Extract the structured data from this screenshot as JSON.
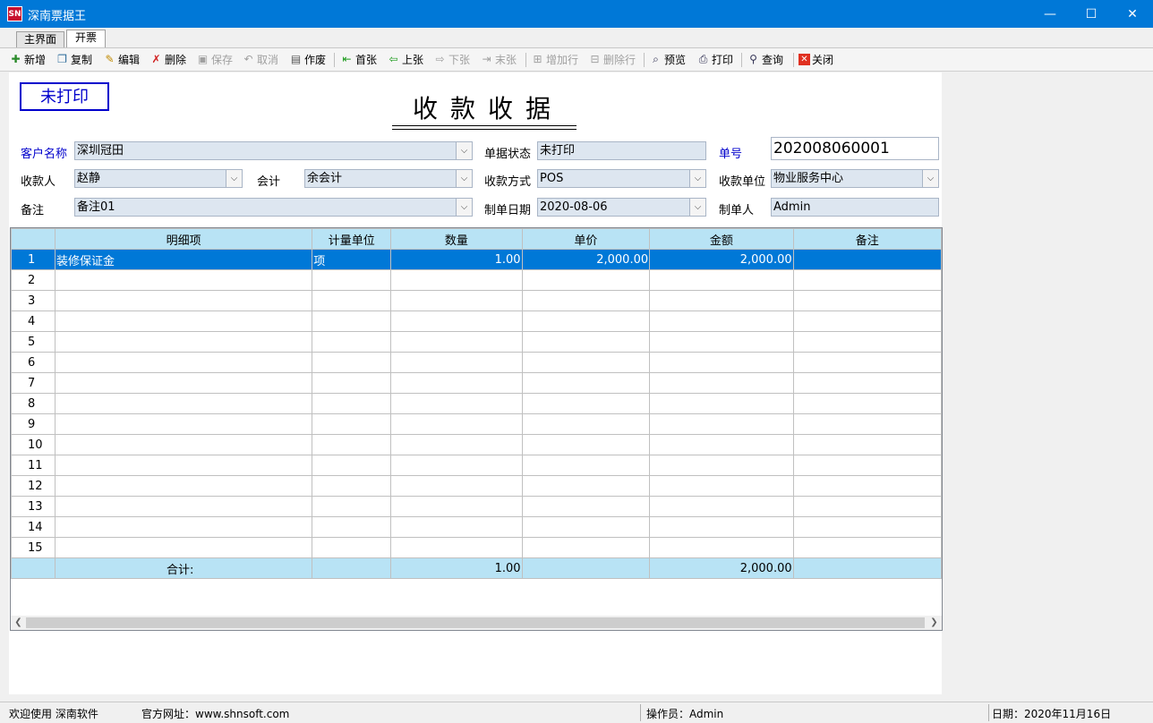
{
  "window": {
    "icon_text": "SN",
    "title": "深南票据王",
    "minimize": "—",
    "maximize": "☐",
    "close": "✕"
  },
  "tabs": [
    {
      "label": "主界面"
    },
    {
      "label": "开票"
    }
  ],
  "toolbar": {
    "new": "新增",
    "copy": "复制",
    "edit": "编辑",
    "delete": "删除",
    "save": "保存",
    "cancel": "取消",
    "void": "作废",
    "first": "首张",
    "prev": "上张",
    "next": "下张",
    "last": "末张",
    "add_row": "增加行",
    "delete_row": "删除行",
    "preview": "预览",
    "print": "打印",
    "query": "查询",
    "close": "关闭"
  },
  "form": {
    "stamp": "未打印",
    "title": "收款收据",
    "customer_label": "客户名称",
    "customer_value": "深圳冠田",
    "status_label": "单据状态",
    "status_value": "未打印",
    "number_label": "单号",
    "number_value": "202008060001",
    "payee_label": "收款人",
    "payee_value": "赵静",
    "accountant_label": "会计",
    "accountant_value": "余会计",
    "method_label": "收款方式",
    "method_value": "POS",
    "unit_label": "收款单位",
    "unit_value": "物业服务中心",
    "note_label": "备注",
    "note_value": "备注01",
    "date_label": "制单日期",
    "date_value": "2020-08-06",
    "maker_label": "制单人",
    "maker_value": "Admin"
  },
  "grid": {
    "columns": [
      "",
      "明细项",
      "计量单位",
      "数量",
      "单价",
      "金额",
      "备注"
    ],
    "rows": [
      [
        "1",
        "装修保证金",
        "项",
        "1.00",
        "2,000.00",
        "2,000.00",
        ""
      ],
      [
        "2",
        "",
        "",
        "",
        "",
        "",
        ""
      ],
      [
        "3",
        "",
        "",
        "",
        "",
        "",
        ""
      ],
      [
        "4",
        "",
        "",
        "",
        "",
        "",
        ""
      ],
      [
        "5",
        "",
        "",
        "",
        "",
        "",
        ""
      ],
      [
        "6",
        "",
        "",
        "",
        "",
        "",
        ""
      ],
      [
        "7",
        "",
        "",
        "",
        "",
        "",
        ""
      ],
      [
        "8",
        "",
        "",
        "",
        "",
        "",
        ""
      ],
      [
        "9",
        "",
        "",
        "",
        "",
        "",
        ""
      ],
      [
        "10",
        "",
        "",
        "",
        "",
        "",
        ""
      ],
      [
        "11",
        "",
        "",
        "",
        "",
        "",
        ""
      ],
      [
        "12",
        "",
        "",
        "",
        "",
        "",
        ""
      ],
      [
        "13",
        "",
        "",
        "",
        "",
        "",
        ""
      ],
      [
        "14",
        "",
        "",
        "",
        "",
        "",
        ""
      ],
      [
        "15",
        "",
        "",
        "",
        "",
        "",
        ""
      ]
    ],
    "total": [
      "",
      "合计:",
      "",
      "1.00",
      "",
      "2,000.00",
      ""
    ]
  },
  "statusbar": {
    "welcome": "欢迎使用 深南软件",
    "website": "官方网址：www.shnsoft.com",
    "operator": "操作员：Admin",
    "date": "日期：2020年11月16日"
  },
  "colors": {
    "titlebar": "#0078d7",
    "selected_row": "#0078d7",
    "grid_header": "#b8e3f5",
    "field_bg": "#dde6f0",
    "stamp": "#0000cc"
  }
}
